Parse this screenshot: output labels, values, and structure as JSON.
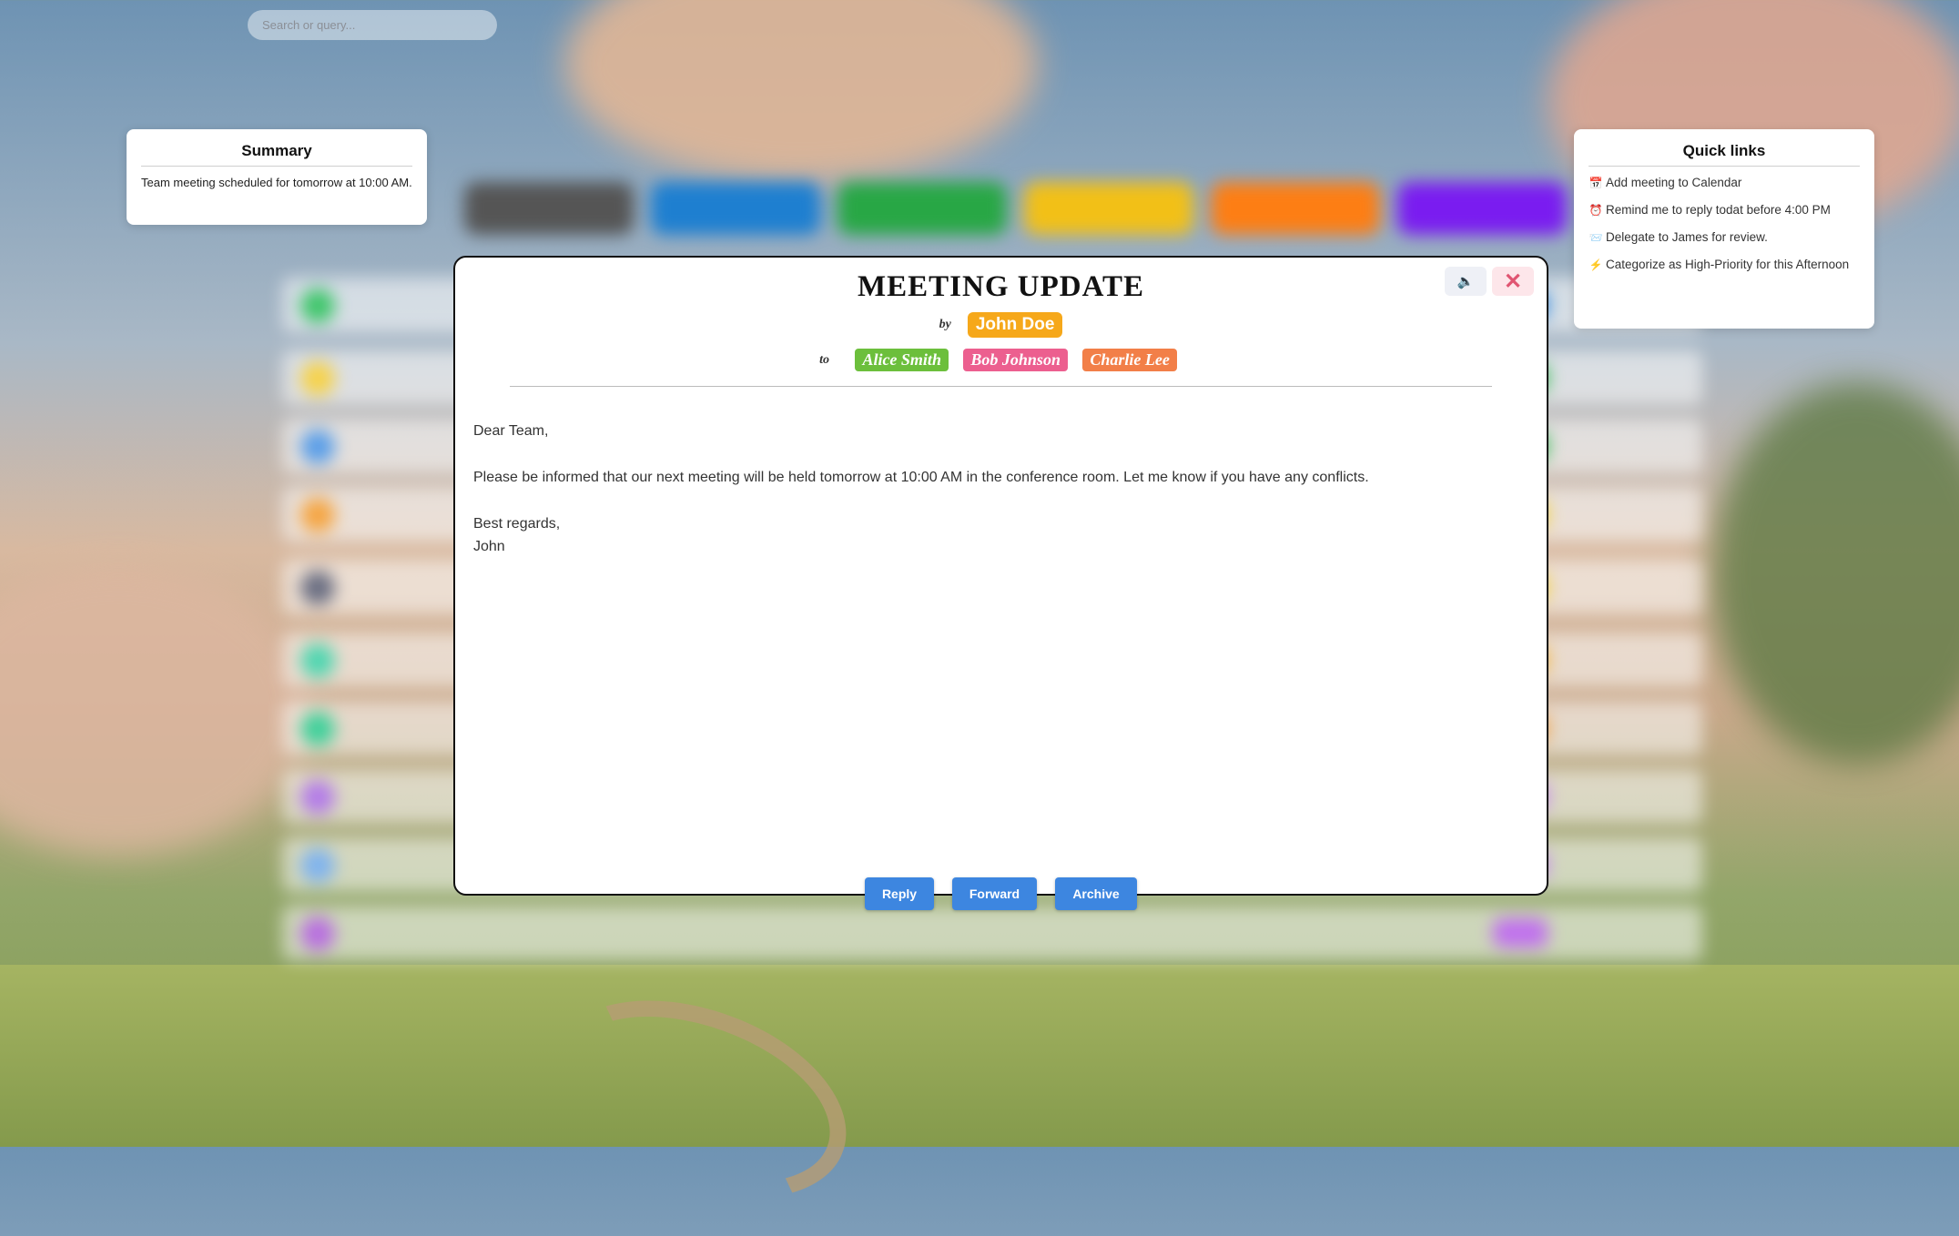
{
  "search": {
    "placeholder": "Search or query..."
  },
  "summary": {
    "title": "Summary",
    "text": "Team meeting scheduled for tomorrow at 10:00 AM."
  },
  "quick_links": {
    "title": "Quick links",
    "items": [
      {
        "icon": "calendar-icon",
        "glyph": "📅",
        "label": "Add meeting to Calendar"
      },
      {
        "icon": "alarm-clock-icon",
        "glyph": "⏰",
        "label": "Remind me to reply todat before 4:00 PM"
      },
      {
        "icon": "envelope-icon",
        "glyph": "📨",
        "label": "Delegate to James for review."
      },
      {
        "icon": "lightning-icon",
        "glyph": "⚡",
        "label": "Categorize as High-Priority for this Afternoon"
      }
    ]
  },
  "email": {
    "subject": "MEETING UPDATE",
    "by_label": "by",
    "author": "John Doe",
    "to_label": "to",
    "recipients": [
      {
        "name": "Alice Smith",
        "color": "#6cbf3c"
      },
      {
        "name": "Bob Johnson",
        "color": "#ec5f8f"
      },
      {
        "name": "Charlie Lee",
        "color": "#f27f48"
      }
    ],
    "body": {
      "greeting": "Dear Team,",
      "message": "Please be informed that our next meeting will be held tomorrow at 10:00 AM in the conference room. Let me know if you have any conflicts.",
      "closing": "Best regards,",
      "signature": "John"
    }
  },
  "actions": {
    "reply": "Reply",
    "forward": "Forward",
    "archive": "Archive"
  },
  "colors": {
    "accent": "#3d86e0",
    "author_badge": "#f6a81a",
    "close": "#e05572"
  }
}
